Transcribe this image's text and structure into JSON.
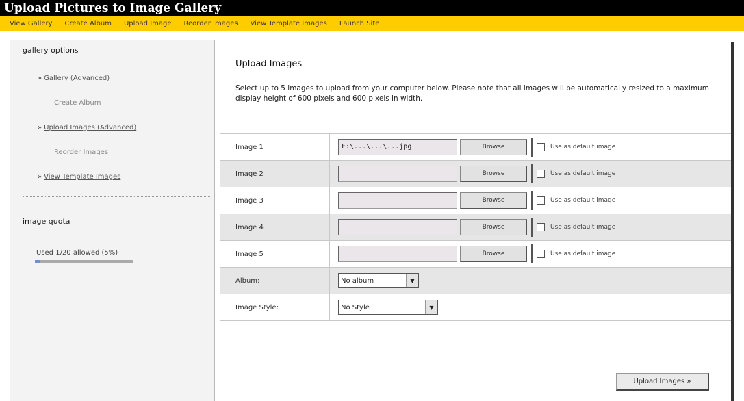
{
  "banner": {
    "text": "Upload Pictures to Image Gallery"
  },
  "nav": {
    "items": [
      {
        "label": "View Gallery"
      },
      {
        "label": "Create Album"
      },
      {
        "label": "Upload Image"
      },
      {
        "label": "Reorder Images"
      },
      {
        "label": "View Template Images"
      },
      {
        "label": "Launch Site"
      }
    ]
  },
  "sidebar": {
    "title": "gallery options",
    "items": [
      {
        "arrow": "»",
        "label": "Gallery (Advanced)"
      },
      {
        "label": "Create Album"
      },
      {
        "arrow": "»",
        "label": "Upload Images (Advanced)"
      },
      {
        "label": "Reorder Images"
      },
      {
        "arrow": "»",
        "label": "View Template Images"
      }
    ],
    "quota_title": "image quota",
    "quota_text": "Used 1/20 allowed (5%)",
    "quota_fraction": 0.05
  },
  "main": {
    "title": "Upload Images",
    "intro": "Select up to 5 images to upload from your computer below. Please note that all images will be automatically resized to a maximum display height of 600 pixels and 600 pixels in width."
  },
  "form": {
    "image_rows": [
      {
        "label": "Image 1",
        "value": "F:\\...\\...\\...jpg",
        "browse": "Browse",
        "checkbox_label": "Use as default image"
      },
      {
        "label": "Image 2",
        "value": "",
        "browse": "Browse",
        "checkbox_label": "Use as default image"
      },
      {
        "label": "Image 3",
        "value": "",
        "browse": "Browse",
        "checkbox_label": "Use as default image"
      },
      {
        "label": "Image 4",
        "value": "",
        "browse": "Browse",
        "checkbox_label": "Use as default image"
      },
      {
        "label": "Image 5",
        "value": "",
        "browse": "Browse",
        "checkbox_label": "Use as default image"
      }
    ],
    "album": {
      "label": "Album:",
      "selected": "No album"
    },
    "style": {
      "label": "Image Style:",
      "selected": "No Style"
    },
    "submit_label": "Upload Images »"
  },
  "colors": {
    "nav_bg": "#ffcc00",
    "sidebar_bg": "#f3f3f3",
    "quota_fill": "#6f93c8"
  }
}
